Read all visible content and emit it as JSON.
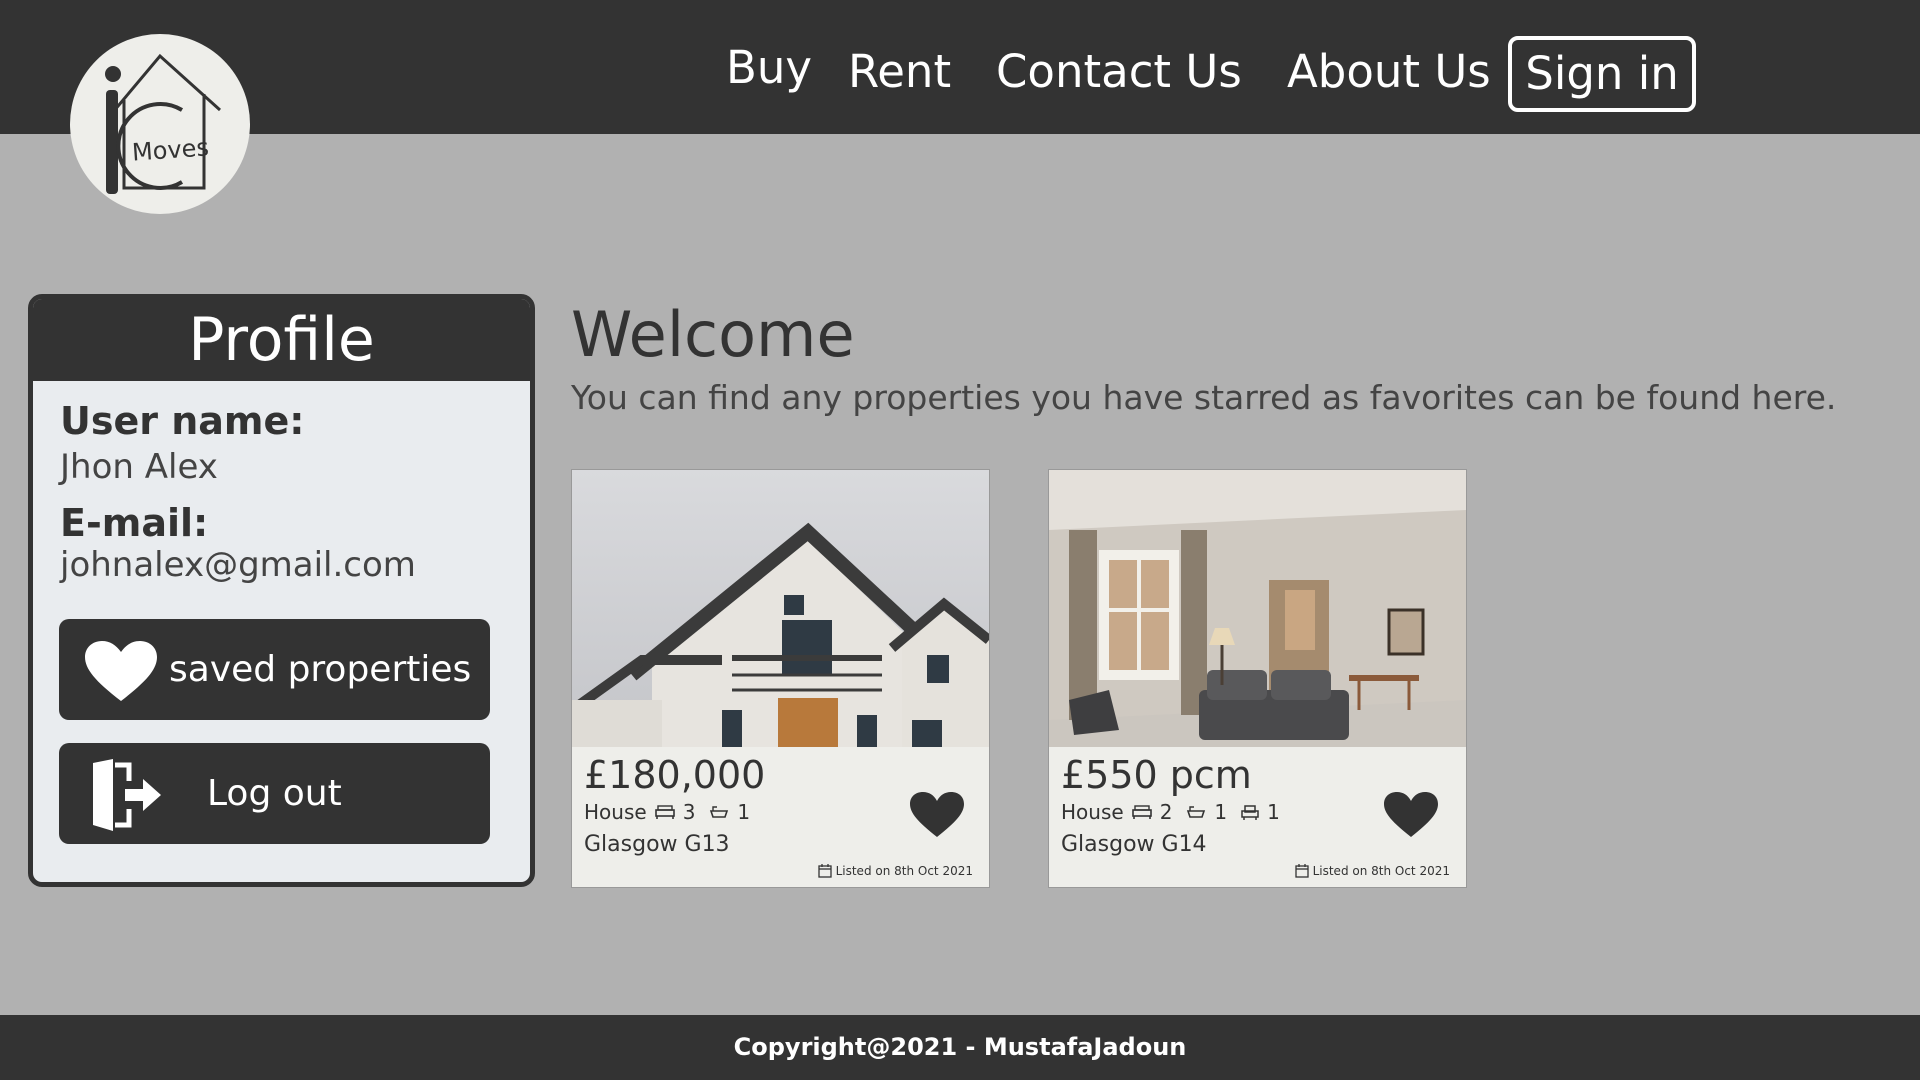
{
  "nav": {
    "items": [
      {
        "label": "Buy"
      },
      {
        "label": "Rent"
      },
      {
        "label": "Contact Us"
      },
      {
        "label": "About Us"
      }
    ],
    "signin_label": "Sign in"
  },
  "logo": {
    "icon": "house-logo-icon",
    "text": "Moves"
  },
  "profile": {
    "title": "Profile",
    "username_label": "User name:",
    "username": "Jhon Alex",
    "email_label": "E-mail:",
    "email": "johnalex@gmail.com",
    "saved_button": "saved properties",
    "logout_button": "Log out"
  },
  "main": {
    "welcome": "Welcome",
    "subtitle": "You can find any properties you have starred as favorites can be found here."
  },
  "properties": [
    {
      "price": "£180,000",
      "type": "House",
      "beds": "3",
      "baths": "1",
      "location": "Glasgow G13",
      "listed": "Listed on 8th Oct 2021",
      "image": "house-exterior-photo"
    },
    {
      "price": "£550 pcm",
      "type": "House",
      "beds": "2",
      "baths": "1",
      "living": "1",
      "location": "Glasgow G14",
      "listed": "Listed on 8th Oct 2021",
      "image": "living-room-photo"
    }
  ],
  "footer": {
    "copyright": "Copyright@2021 - MustafaJadoun"
  },
  "colors": {
    "dark": "#333333",
    "background": "#b1b1b1",
    "panel": "#e9ecef",
    "card": "#eeeeea"
  }
}
